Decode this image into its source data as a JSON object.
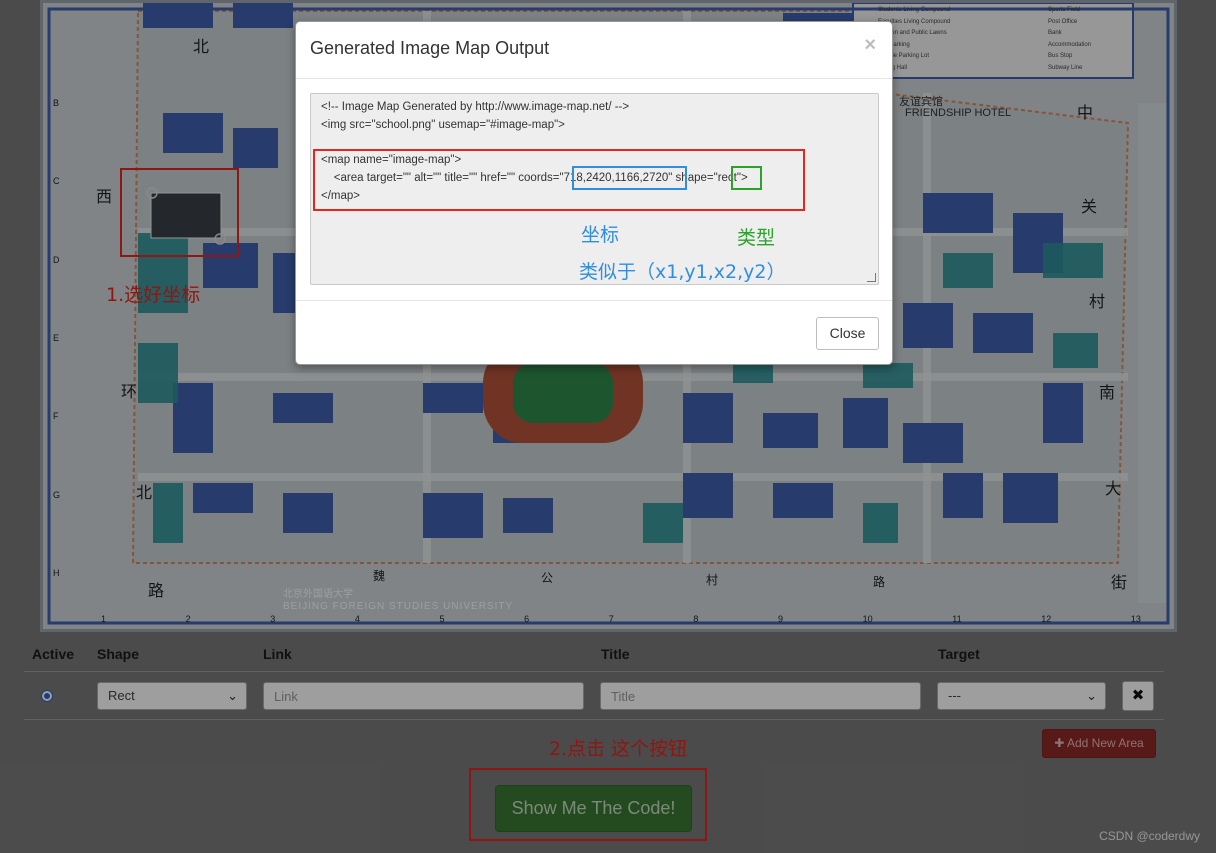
{
  "map": {
    "compass_labels": [
      "北",
      "西",
      "环",
      "北",
      "路",
      "中",
      "关",
      "村",
      "南",
      "大",
      "街",
      "魏",
      "公",
      "村",
      "路"
    ],
    "column_markers": [
      "1",
      "2",
      "3",
      "4",
      "5",
      "6",
      "7",
      "8",
      "9",
      "10",
      "11",
      "12",
      "13"
    ],
    "row_markers": [
      "B",
      "C",
      "D",
      "E",
      "F",
      "G",
      "H"
    ],
    "bottom_caption_cn": "北京外国语大学",
    "bottom_caption_en": "BEIJING FOREIGN STUDIES UNIVERSITY",
    "hotel_label_cn": "友谊宾馆",
    "hotel_label_en": "FRIENDSHIP HOTEL",
    "legend_items": [
      "Students Living Compound",
      "Faculties Living Compound",
      "Garden and Public Lawns",
      "Car Parking",
      "Bicycle Parking Lot",
      "Dining Hall",
      "Sports Field",
      "Post Office",
      "Bank",
      "Accommodation",
      "Bus Stop",
      "Subway Line"
    ]
  },
  "table": {
    "headers": {
      "active": "Active",
      "shape": "Shape",
      "link": "Link",
      "title": "Title",
      "target": "Target"
    },
    "row": {
      "shape_value": "Rect",
      "link_placeholder": "Link",
      "title_placeholder": "Title",
      "target_value": "---",
      "delete_icon": "✖"
    }
  },
  "buttons": {
    "add_area_label": "Add New Area",
    "show_code_label": "Show Me The Code!"
  },
  "modal": {
    "title": "Generated Image Map Output",
    "close_x": "×",
    "close_button": "Close",
    "code_lines": [
      "<!-- Image Map Generated by http://www.image-map.net/ -->",
      "<img src=\"school.png\" usemap=\"#image-map\">",
      "",
      "<map name=\"image-map\">",
      "    <area target=\"\" alt=\"\" title=\"\" href=\"\" coords=\"",
      "718,2420,1166,2720",
      "\" shape=\"",
      "rect",
      "\">",
      "</map>"
    ]
  },
  "annotations": {
    "step1": "1.选好坐标",
    "step2": "2.点击 这个按钮",
    "coords_label": "坐标",
    "type_label": "类型",
    "similar_label": "类似于（x1,y1,x2,y2）"
  },
  "watermark": "CSDN @coderdwy",
  "colors": {
    "annotation_red": "#e8241c",
    "annotation_blue": "#2f8ee0",
    "annotation_green": "#2aa32a",
    "show_code_green": "#5cb85c",
    "add_area_red": "#d9534f"
  }
}
